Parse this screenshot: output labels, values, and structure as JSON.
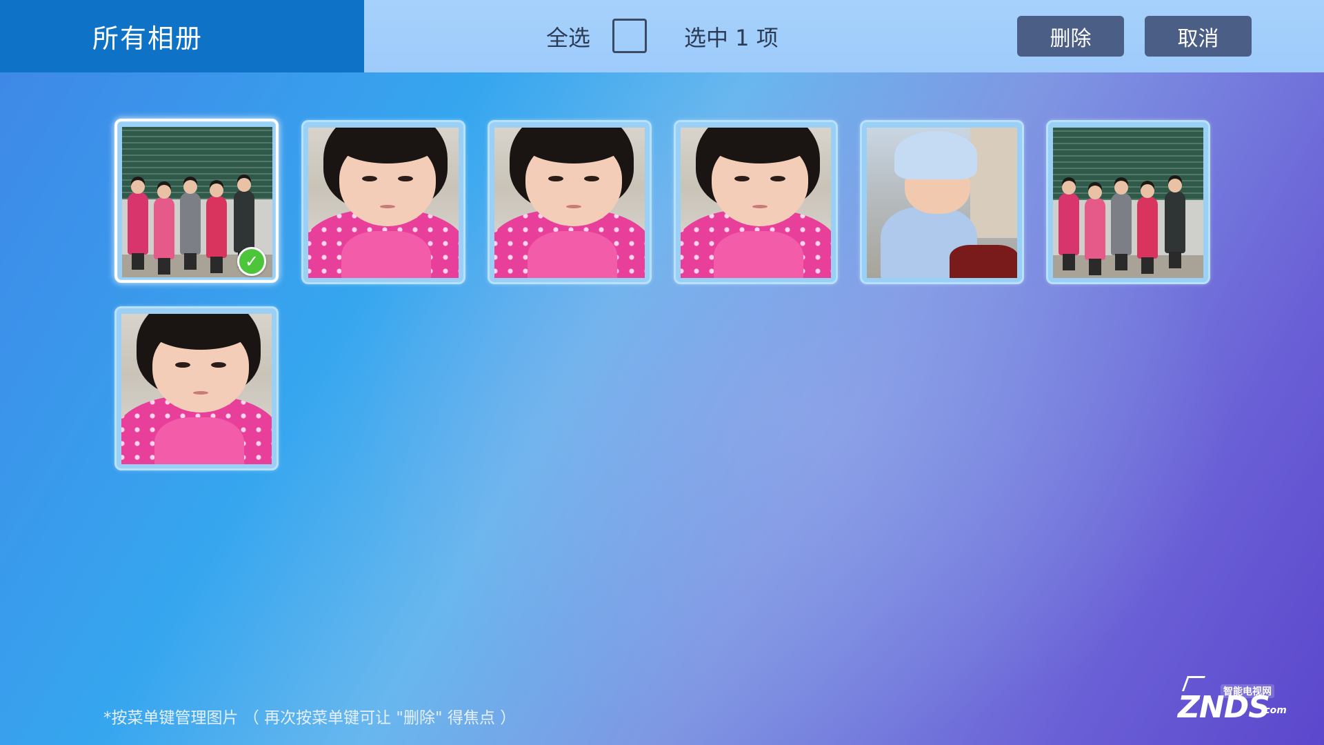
{
  "header": {
    "album_title": "所有相册",
    "select_all_label": "全选",
    "select_all_checked": false,
    "selected_count_text": "选中 1 项",
    "delete_label": "删除",
    "cancel_label": "取消"
  },
  "photos": [
    {
      "subject": "group-photo",
      "selected": true,
      "focused": true
    },
    {
      "subject": "girl-portrait",
      "selected": false,
      "focused": false
    },
    {
      "subject": "girl-portrait",
      "selected": false,
      "focused": false
    },
    {
      "subject": "girl-portrait",
      "selected": false,
      "focused": false
    },
    {
      "subject": "baby-photo",
      "selected": false,
      "focused": false
    },
    {
      "subject": "group-photo",
      "selected": false,
      "focused": false
    },
    {
      "subject": "girl-portrait",
      "selected": false,
      "focused": false
    }
  ],
  "check_icon": "check-icon",
  "footer": {
    "hint": "*按菜单键管理图片 （ 再次按菜单键可让 \"删除\" 得焦点 ）"
  },
  "watermark": {
    "brand": "ZNDS",
    "domain": ".com",
    "subtitle": "智能电视网"
  },
  "colors": {
    "title_bar": "#0e72c6",
    "toolbar": "#a6d1fb",
    "button": "#4b5f86",
    "check": "#4cc53a"
  }
}
